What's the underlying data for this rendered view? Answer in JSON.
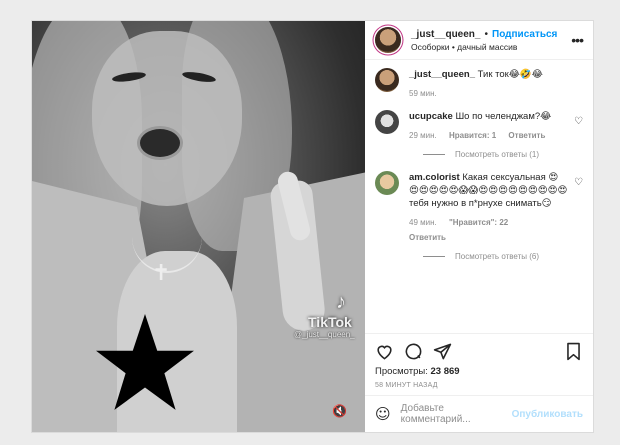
{
  "post": {
    "video": {
      "watermark_brand": "TikTok",
      "watermark_user": "@_just__queen_",
      "sound_icon": "speaker-icon"
    },
    "header": {
      "username": "_just__queen_",
      "separator": "•",
      "follow_label": "Подписаться",
      "location": "Особорки • дачный массив"
    },
    "caption": {
      "username": "_just__queen_",
      "text": " Тик ток😂🤣😂",
      "time": "59 мин."
    },
    "comments": [
      {
        "username": "ucupcake",
        "text": " Шо по челенджам?😂",
        "time": "29 мин.",
        "likes": "Нравится: 1",
        "reply": "Ответить",
        "view_replies": "Посмотреть ответы (1)"
      },
      {
        "username": "am.colorist",
        "text": " Какая сексуальная 😍😍😍😍😍😍😱😱😍😍😍😍😍😍😍😍😍тебя нужно в п*рнухе снимать😏",
        "time": "49 мин.",
        "likes": "\"Нравится\": 22",
        "reply": "Ответить",
        "view_replies": "Посмотреть ответы (6)"
      }
    ],
    "views": {
      "label": "Просмотры:",
      "count": "23 869"
    },
    "ago": "58 МИНУТ НАЗАД",
    "add_comment": {
      "placeholder": "Добавьте комментарий...",
      "publish": "Опубликовать"
    }
  }
}
